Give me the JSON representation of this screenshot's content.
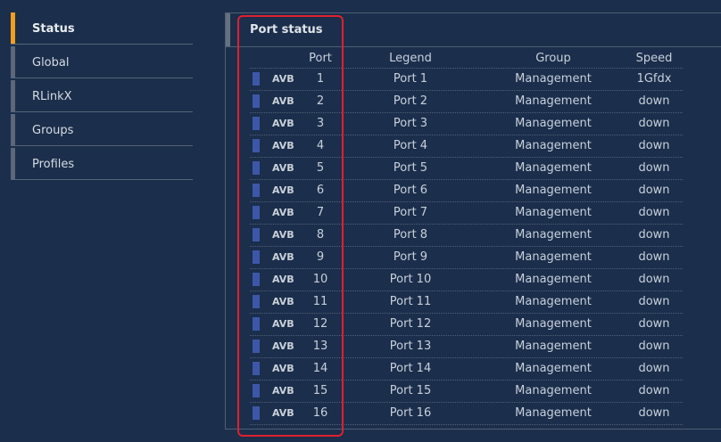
{
  "sidebar": {
    "items": [
      {
        "label": "Status",
        "active": true
      },
      {
        "label": "Global",
        "active": false
      },
      {
        "label": "RLinkX",
        "active": false
      },
      {
        "label": "Groups",
        "active": false
      },
      {
        "label": "Profiles",
        "active": false
      }
    ]
  },
  "panel": {
    "title": "Port status"
  },
  "table": {
    "headers": {
      "port": "Port",
      "legend": "Legend",
      "group": "Group",
      "speed": "Speed"
    },
    "rows": [
      {
        "badge": "AVB",
        "port": "1",
        "legend": "Port 1",
        "group": "Management",
        "speed": "1Gfdx"
      },
      {
        "badge": "AVB",
        "port": "2",
        "legend": "Port 2",
        "group": "Management",
        "speed": "down"
      },
      {
        "badge": "AVB",
        "port": "3",
        "legend": "Port 3",
        "group": "Management",
        "speed": "down"
      },
      {
        "badge": "AVB",
        "port": "4",
        "legend": "Port 4",
        "group": "Management",
        "speed": "down"
      },
      {
        "badge": "AVB",
        "port": "5",
        "legend": "Port 5",
        "group": "Management",
        "speed": "down"
      },
      {
        "badge": "AVB",
        "port": "6",
        "legend": "Port 6",
        "group": "Management",
        "speed": "down"
      },
      {
        "badge": "AVB",
        "port": "7",
        "legend": "Port 7",
        "group": "Management",
        "speed": "down"
      },
      {
        "badge": "AVB",
        "port": "8",
        "legend": "Port 8",
        "group": "Management",
        "speed": "down"
      },
      {
        "badge": "AVB",
        "port": "9",
        "legend": "Port 9",
        "group": "Management",
        "speed": "down"
      },
      {
        "badge": "AVB",
        "port": "10",
        "legend": "Port 10",
        "group": "Management",
        "speed": "down"
      },
      {
        "badge": "AVB",
        "port": "11",
        "legend": "Port 11",
        "group": "Management",
        "speed": "down"
      },
      {
        "badge": "AVB",
        "port": "12",
        "legend": "Port 12",
        "group": "Management",
        "speed": "down"
      },
      {
        "badge": "AVB",
        "port": "13",
        "legend": "Port 13",
        "group": "Management",
        "speed": "down"
      },
      {
        "badge": "AVB",
        "port": "14",
        "legend": "Port 14",
        "group": "Management",
        "speed": "down"
      },
      {
        "badge": "AVB",
        "port": "15",
        "legend": "Port 15",
        "group": "Management",
        "speed": "down"
      },
      {
        "badge": "AVB",
        "port": "16",
        "legend": "Port 16",
        "group": "Management",
        "speed": "down"
      }
    ]
  },
  "colors": {
    "background": "#1b2e4b",
    "active_accent": "#f0a01e",
    "avb_marker": "#3d57a8",
    "highlight": "#e0202e"
  }
}
